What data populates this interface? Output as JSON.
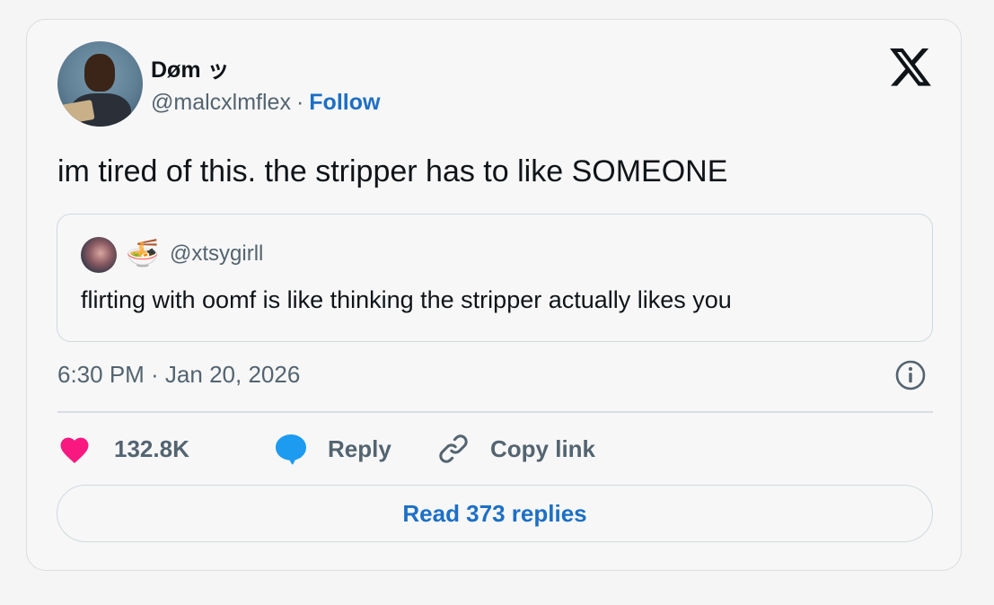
{
  "author": {
    "name": "Døm ッ",
    "handle": "@malcxlmflex",
    "separator": "·",
    "follow_label": "Follow"
  },
  "tweet": {
    "text": "im tired of this. the stripper has to like SOMEONE",
    "timestamp": "6:30 PM · Jan 20, 2026"
  },
  "quoted_tweet": {
    "emoji": "🍜",
    "handle": "@xtsygirll",
    "text": "flirting with oomf is like thinking the stripper actually likes you"
  },
  "actions": {
    "like_count": "132.8K",
    "reply_label": "Reply",
    "copy_link_label": "Copy link"
  },
  "read_replies_label": "Read 373 replies",
  "icons": {
    "brand": "x-logo-icon",
    "info": "info-icon",
    "like": "heart-icon",
    "reply": "speech-bubble-icon",
    "copy": "link-icon"
  },
  "colors": {
    "like": "#f91880",
    "reply": "#1d9bf0",
    "follow": "#1d6fc5",
    "secondary_text": "#536471"
  }
}
